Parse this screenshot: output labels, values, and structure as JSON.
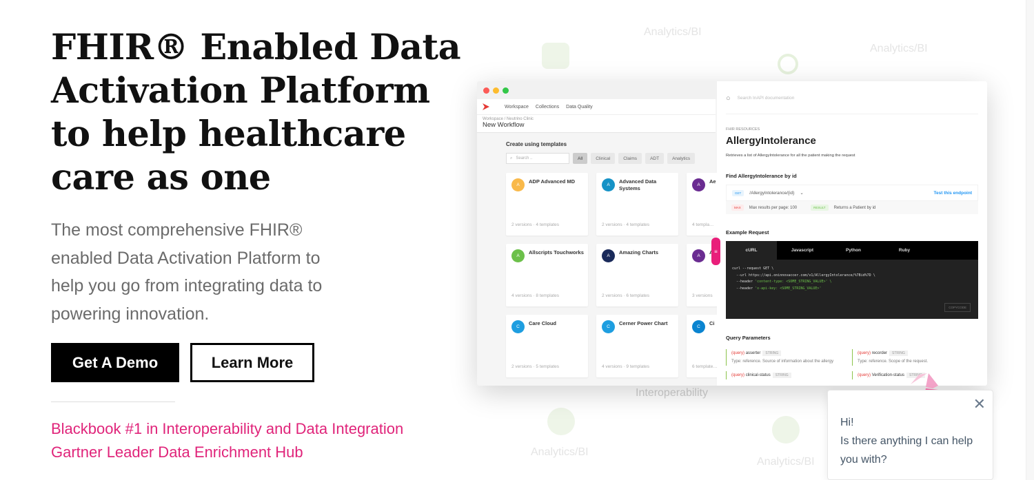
{
  "hero": {
    "title": "FHIR® Enabled Data Activation Platform to help healthcare care as one",
    "subtitle": "The most comprehensive FHIR® enabled Data Activation Platform to help you go from integrating data to powering innovation.",
    "demo_button": "Get A Demo",
    "learn_button": "Learn More",
    "awards": [
      "Blackbook #1 in Interoperability and Data Integration",
      "Gartner Leader Data Enrichment Hub"
    ]
  },
  "background_labels": [
    "Analytics/BI",
    "Analytics/BI",
    "Interoperability",
    "Analytics/BI",
    "Analytics/BI"
  ],
  "app": {
    "nav": [
      "Workspace",
      "Collections",
      "Data Quality"
    ],
    "breadcrumb": "Workspace / Neutrino Clinic",
    "page_title": "New Workflow",
    "section_title": "Create using templates",
    "search_placeholder": "Search ..",
    "filters": [
      "All",
      "Clinical",
      "Claims",
      "ADT",
      "Analytics"
    ],
    "cards": [
      {
        "initial": "A",
        "name": "ADP Advanced MD",
        "meta": "2 versions · 4 templates",
        "color": "#f9b94a"
      },
      {
        "initial": "A",
        "name": "Advanced Data Systems",
        "meta": "2 versions · 4 templates",
        "color": "#1592c6"
      },
      {
        "initial": "A",
        "name": "Ae",
        "meta": "4 templa…",
        "color": "#6a2c91"
      },
      {
        "initial": "A",
        "name": "Allscripts Touchworks",
        "meta": "4 versions · 8 templates",
        "color": "#6cc04a"
      },
      {
        "initial": "A",
        "name": "Amazing Charts",
        "meta": "2 versions · 6 templates",
        "color": "#1a2a5a"
      },
      {
        "initial": "A",
        "name": "At",
        "meta": "3 versions",
        "color": "#6a2c91"
      },
      {
        "initial": "C",
        "name": "Care Cloud",
        "meta": "2 versions · 5 templates",
        "color": "#1e9ee0"
      },
      {
        "initial": "C",
        "name": "Cerner Power Chart",
        "meta": "4 versions · 9 templates",
        "color": "#1e9ee0"
      },
      {
        "initial": "C",
        "name": "Ci",
        "meta": "6 template…",
        "color": "#0a84d0"
      }
    ]
  },
  "docs": {
    "search_placeholder": "Search InAPI documentation",
    "section": "FHIR RESOURCES",
    "title": "AllergyIntolerance",
    "description": "Retrieves a list of AllergyIntolerance for all the patient making the request",
    "find_title": "Find AllergyIntolerance by id",
    "method": "GET",
    "path": "/AllergyIntolerance/{id}",
    "test_link": "Test this endpoint",
    "max_tag": "MAX",
    "max_text": "Max results per page: 100",
    "result_tag": "RESULT",
    "result_text": "Returns a Patient by id",
    "example_title": "Example Request",
    "code_tabs": [
      "cURL",
      "Javascript",
      "Python",
      "Ruby"
    ],
    "code_lines": [
      "curl --request GET \\",
      "  --url https://api.oninnovaccer.com/v1/AllergyIntolerance/%7Bid%7D \\",
      "  --header ",
      "  --header "
    ],
    "code_strings": [
      "'content-type: <SOME_STRING_VALUE>' \\",
      "'x-api-key: <SOME_STRING_VALUE>'"
    ],
    "copy_button": "COPYCODE",
    "params_title": "Query Parameters",
    "params": [
      {
        "q": "(query)",
        "name": "asserter",
        "type": "STRING",
        "desc": "Type: reference. Source of information about the allergy"
      },
      {
        "q": "(query)",
        "name": "recorder",
        "type": "STRING",
        "desc": "Type: reference. Scope of the request."
      },
      {
        "q": "(query)",
        "name": "clinical-status",
        "type": "STRING",
        "desc": ""
      },
      {
        "q": "(query)",
        "name": "Verification-status",
        "type": "STRING",
        "desc": ""
      }
    ]
  },
  "chat": {
    "greeting": "Hi!",
    "message": "Is there anything I can help you with?"
  },
  "colors": {
    "accent": "#e0247a",
    "button": "#000000"
  }
}
